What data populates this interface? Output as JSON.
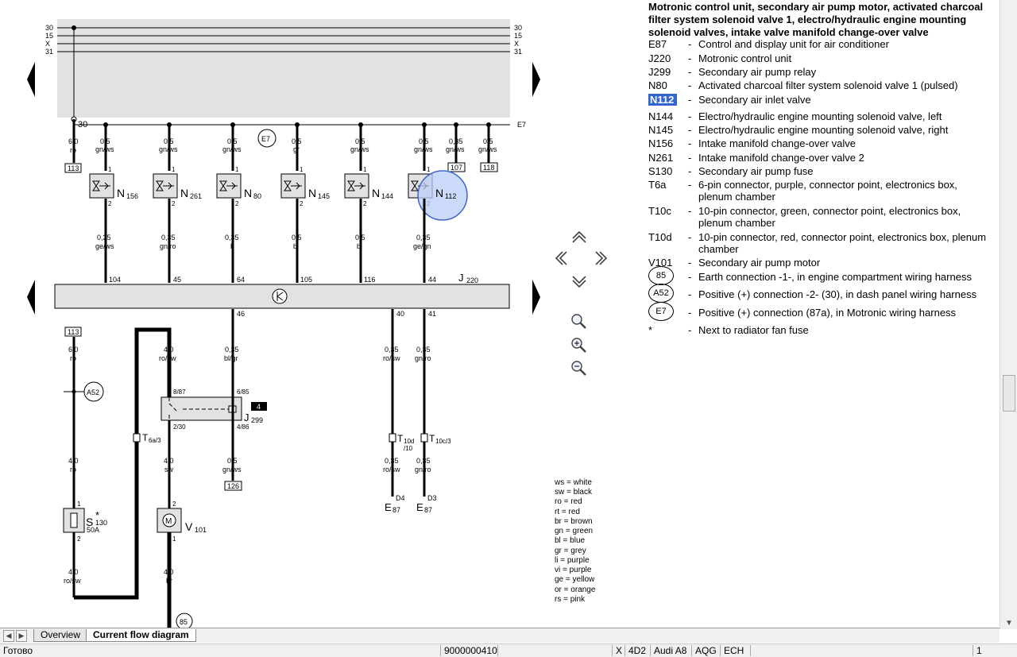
{
  "diagram": {
    "rails": [
      "30",
      "15",
      "X",
      "31"
    ],
    "e7_label": "E7",
    "term30": "30",
    "top_wires": [
      {
        "size": "0,5",
        "color": "gn/ws"
      },
      {
        "size": "0,5",
        "color": "gn/ws"
      },
      {
        "size": "0,5",
        "color": "gn/ws"
      },
      {
        "size": "0,5",
        "color": "gr"
      },
      {
        "size": "0,5",
        "color": "gn/ws"
      },
      {
        "size": "0,5",
        "color": "gn/ws"
      },
      {
        "size": "0,35",
        "color": "gn/ws"
      },
      {
        "size": "0,5",
        "color": "gn/ws"
      }
    ],
    "first_wire": {
      "size": "6,0",
      "color": "ro"
    },
    "refs": {
      "r113": "113",
      "r107": "107",
      "r118": "118",
      "r126": "126",
      "r113b": "113"
    },
    "valves": [
      {
        "code": "N",
        "sub": "156"
      },
      {
        "code": "N",
        "sub": "261"
      },
      {
        "code": "N",
        "sub": "80"
      },
      {
        "code": "N",
        "sub": "145"
      },
      {
        "code": "N",
        "sub": "144"
      },
      {
        "code": "N",
        "sub": "112"
      }
    ],
    "pin1": "1",
    "pin2": "2",
    "bottom_wires": [
      {
        "size": "0,35",
        "color": "ge/ws",
        "pin": "104"
      },
      {
        "size": "0,35",
        "color": "gn/ro",
        "pin": "45"
      },
      {
        "size": "0,35",
        "color": "li",
        "pin": "64"
      },
      {
        "size": "0,5",
        "color": "bl",
        "pin": "105"
      },
      {
        "size": "0,5",
        "color": "bl",
        "pin": "116"
      },
      {
        "size": "0,35",
        "color": "ge/gn",
        "pin": "44"
      }
    ],
    "j220": {
      "code": "J",
      "sub": "220"
    },
    "lower_pins": {
      "p46": "46",
      "p40": "40",
      "p41": "41"
    },
    "lower_wires": {
      "w1": {
        "size": "6,0",
        "color": "ro"
      },
      "w2": {
        "size": "4,0",
        "color": "ro/sw"
      },
      "w3": {
        "size": "0,35",
        "color": "bl/gr"
      },
      "w4": {
        "size": "0,35",
        "color": "ro/sw"
      },
      "w5": {
        "size": "0,35",
        "color": "gn/ro"
      },
      "w6": {
        "size": "4,0",
        "color": "ro"
      },
      "w7": {
        "size": "4,0",
        "color": "sw"
      },
      "w8": {
        "size": "0,5",
        "color": "gn/ws"
      },
      "w9": {
        "size": "0,35",
        "color": "ro/sw"
      },
      "w10": {
        "size": "0,35",
        "color": "gn/ro"
      },
      "w11": {
        "size": "4,0",
        "color": "ro/sw"
      },
      "w12": {
        "size": "4,0",
        "color": "br"
      }
    },
    "a52": "A52",
    "relay": {
      "code": "J",
      "sub": "299",
      "p1": "8/87",
      "p2": "6/85",
      "p3": "2/30",
      "p4": "4/86",
      "badge": "4"
    },
    "t6a": {
      "code": "T",
      "sub": "6a/3"
    },
    "t10d": {
      "code": "T",
      "sub": "10d",
      "sub2": "/10"
    },
    "t10c": {
      "code": "T",
      "sub": "10c/3"
    },
    "d4": "D4",
    "d3": "D3",
    "e87": {
      "code": "E",
      "sub": "87"
    },
    "fuse": {
      "code": "S",
      "sub": "130",
      "star": "*",
      "amp": "50A"
    },
    "motor": {
      "code": "V",
      "sub": "101",
      "glyph": "M"
    },
    "earth85": "85",
    "color_key": [
      "ws = white",
      "sw = black",
      "ro = red",
      "rt = red",
      "br = brown",
      "gn = green",
      "bl = blue",
      "gr = grey",
      "li = purple",
      "vi = purple",
      "ge = yellow",
      "or = orange",
      "rs = pink"
    ]
  },
  "legend": {
    "title": "Motronic control unit, secondary air pump motor, activated charcoal filter system solenoid valve 1, electro/hydraulic engine mounting solenoid valves, intake valve manifold change-over valve",
    "items": [
      {
        "code": "E87",
        "desc": "Control and display unit for air conditioner"
      },
      {
        "code": "J220",
        "desc": "Motronic control unit"
      },
      {
        "code": "J299",
        "desc": "Secondary air pump relay"
      },
      {
        "code": "N80",
        "desc": "Activated charcoal filter system solenoid valve 1 (pulsed)"
      },
      {
        "code": "N112",
        "desc": "Secondary air inlet valve"
      },
      {
        "code": "N144",
        "desc": "Electro/hydraulic engine mounting solenoid valve, left"
      },
      {
        "code": "N145",
        "desc": "Electro/hydraulic engine mounting solenoid valve, right"
      },
      {
        "code": "N156",
        "desc": "Intake manifold change-over valve"
      },
      {
        "code": "N261",
        "desc": "Intake manifold change-over valve 2"
      },
      {
        "code": "S130",
        "desc": "Secondary air pump fuse"
      },
      {
        "code": "T6a",
        "desc": "6-pin connector, purple, connector point, electronics box, plenum chamber"
      },
      {
        "code": "T10c",
        "desc": "10-pin connector, green, connector point, electronics box, plenum chamber"
      },
      {
        "code": "T10d",
        "desc": "10-pin connector, red, connector point, electronics box, plenum chamber"
      },
      {
        "code": "V101",
        "desc": "Secondary air pump motor"
      },
      {
        "code": "85",
        "desc": "Earth connection -1-, in engine compartment wiring harness"
      },
      {
        "code": "A52",
        "desc": "Positive (+) connection -2- (30), in dash panel wiring harness"
      },
      {
        "code": "E7",
        "desc": "Positive (+) connection (87a), in Motronic wiring harness"
      },
      {
        "code": "*",
        "desc": "Next to radiator fan fuse"
      }
    ]
  },
  "tabs": {
    "overview": "Overview",
    "current": "Current flow diagram"
  },
  "status": {
    "ready": "Готово",
    "doc_id": "9000000410",
    "x": "X",
    "body": "4D2",
    "model": "Audi A8",
    "engine": "AQG",
    "gearbox": "ECH",
    "page": "1"
  },
  "colors": {
    "panel": "#e2e2e2",
    "highlight": "#3366cc",
    "magnifier": "#b9cdf5"
  }
}
